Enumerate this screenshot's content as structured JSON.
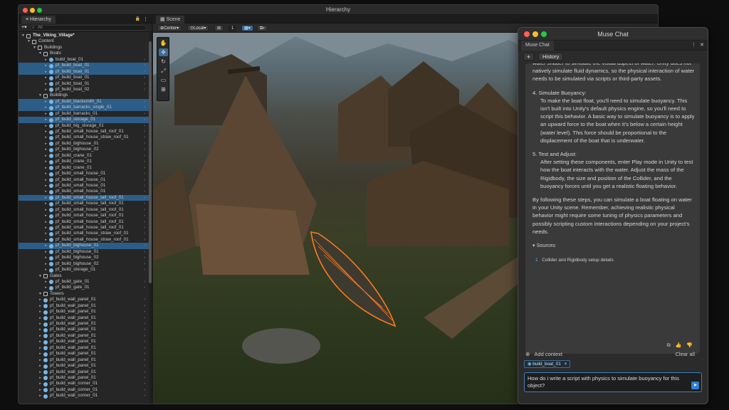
{
  "window": {
    "title": "Hierarchy"
  },
  "hierarchy": {
    "tab_label": "Hierarchy",
    "search_placeholder": "All",
    "rows": [
      {
        "label": "The_Viking_Village*",
        "depth": 0,
        "kind": "scene",
        "expanded": true,
        "selected": false,
        "bold": true
      },
      {
        "label": "Content",
        "depth": 1,
        "kind": "group",
        "expanded": true,
        "selected": false
      },
      {
        "label": "Buildings",
        "depth": 2,
        "kind": "group",
        "expanded": true,
        "selected": false
      },
      {
        "label": "Boats",
        "depth": 3,
        "kind": "group",
        "expanded": true,
        "selected": false
      },
      {
        "label": "build_boat_01",
        "depth": 4,
        "kind": "prefab",
        "selected": false
      },
      {
        "label": "pf_build_boat_01",
        "depth": 4,
        "kind": "prefab",
        "selected": true
      },
      {
        "label": "pf_build_boat_01",
        "depth": 4,
        "kind": "prefab",
        "selected": true
      },
      {
        "label": "pf_build_boat_01",
        "depth": 4,
        "kind": "prefab",
        "selected": false
      },
      {
        "label": "pf_build_boat_01",
        "depth": 4,
        "kind": "prefab",
        "selected": false
      },
      {
        "label": "pf_build_boat_02",
        "depth": 4,
        "kind": "prefab",
        "selected": false
      },
      {
        "label": "Buildings",
        "depth": 3,
        "kind": "group",
        "expanded": true,
        "selected": false
      },
      {
        "label": "pf_build_blacksmith_01",
        "depth": 4,
        "kind": "prefab",
        "selected": true
      },
      {
        "label": "pf_build_barracks_single_01",
        "depth": 4,
        "kind": "prefab",
        "selected": true
      },
      {
        "label": "pf_build_barracks_01",
        "depth": 4,
        "kind": "prefab",
        "selected": false
      },
      {
        "label": "pf_build_storage_01",
        "depth": 4,
        "kind": "prefab",
        "selected": true
      },
      {
        "label": "pf_build_big_storage_01",
        "depth": 4,
        "kind": "prefab",
        "selected": false
      },
      {
        "label": "pf_build_small_house_tall_roof_01",
        "depth": 4,
        "kind": "prefab",
        "selected": false
      },
      {
        "label": "pf_build_small_house_straw_roof_01",
        "depth": 4,
        "kind": "prefab",
        "selected": false
      },
      {
        "label": "pf_build_bighouse_01",
        "depth": 4,
        "kind": "prefab",
        "selected": false
      },
      {
        "label": "pf_build_bighouse_02",
        "depth": 4,
        "kind": "prefab",
        "selected": false
      },
      {
        "label": "pf_build_crane_01",
        "depth": 4,
        "kind": "prefab",
        "selected": false
      },
      {
        "label": "pf_build_crane_01",
        "depth": 4,
        "kind": "prefab",
        "selected": false
      },
      {
        "label": "pf_build_crane_01",
        "depth": 4,
        "kind": "prefab",
        "selected": false
      },
      {
        "label": "pf_build_small_house_01",
        "depth": 4,
        "kind": "prefab",
        "selected": false
      },
      {
        "label": "pf_build_small_house_01",
        "depth": 4,
        "kind": "prefab",
        "selected": false
      },
      {
        "label": "pf_build_small_house_01",
        "depth": 4,
        "kind": "prefab",
        "selected": false
      },
      {
        "label": "pf_build_small_house_01",
        "depth": 4,
        "kind": "prefab",
        "selected": false
      },
      {
        "label": "pf_build_small_house_tall_roof_01",
        "depth": 4,
        "kind": "prefab",
        "selected": true
      },
      {
        "label": "pf_build_small_house_tall_roof_01",
        "depth": 4,
        "kind": "prefab",
        "selected": false
      },
      {
        "label": "pf_build_small_house_tall_roof_01",
        "depth": 4,
        "kind": "prefab",
        "selected": false
      },
      {
        "label": "pf_build_small_house_tall_roof_01",
        "depth": 4,
        "kind": "prefab",
        "selected": false
      },
      {
        "label": "pf_build_small_house_tall_roof_01",
        "depth": 4,
        "kind": "prefab",
        "selected": false
      },
      {
        "label": "pf_build_small_house_tall_roof_01",
        "depth": 4,
        "kind": "prefab",
        "selected": false
      },
      {
        "label": "pf_build_small_house_straw_roof_01",
        "depth": 4,
        "kind": "prefab",
        "selected": false
      },
      {
        "label": "pf_build_small_house_straw_roof_01",
        "depth": 4,
        "kind": "prefab",
        "selected": false
      },
      {
        "label": "pf_build_bighouse_01",
        "depth": 4,
        "kind": "prefab",
        "selected": true
      },
      {
        "label": "pf_build_bighouse_01",
        "depth": 4,
        "kind": "prefab",
        "selected": false
      },
      {
        "label": "pf_build_bighouse_02",
        "depth": 4,
        "kind": "prefab",
        "selected": false
      },
      {
        "label": "pf_build_bighouse_02",
        "depth": 4,
        "kind": "prefab",
        "selected": false
      },
      {
        "label": "pf_build_storage_01",
        "depth": 4,
        "kind": "prefab",
        "selected": false
      },
      {
        "label": "Gates",
        "depth": 3,
        "kind": "group",
        "expanded": true,
        "selected": false
      },
      {
        "label": "pf_build_gate_01",
        "depth": 4,
        "kind": "prefab",
        "selected": false
      },
      {
        "label": "pf_build_gate_01",
        "depth": 4,
        "kind": "prefab",
        "selected": false
      },
      {
        "label": "Towers",
        "depth": 3,
        "kind": "group",
        "expanded": true,
        "selected": false
      },
      {
        "label": "pf_build_wall_panel_01",
        "depth": 3,
        "kind": "prefab",
        "selected": false
      },
      {
        "label": "pf_build_wall_panel_01",
        "depth": 3,
        "kind": "prefab",
        "selected": false
      },
      {
        "label": "pf_build_wall_panel_01",
        "depth": 3,
        "kind": "prefab",
        "selected": false
      },
      {
        "label": "pf_build_wall_panel_01",
        "depth": 3,
        "kind": "prefab",
        "selected": false
      },
      {
        "label": "pf_build_wall_panel_01",
        "depth": 3,
        "kind": "prefab",
        "selected": false
      },
      {
        "label": "pf_build_wall_panel_01",
        "depth": 3,
        "kind": "prefab",
        "selected": false
      },
      {
        "label": "pf_build_wall_panel_01",
        "depth": 3,
        "kind": "prefab",
        "selected": false
      },
      {
        "label": "pf_build_wall_panel_01",
        "depth": 3,
        "kind": "prefab",
        "selected": false
      },
      {
        "label": "pf_build_wall_panel_01",
        "depth": 3,
        "kind": "prefab",
        "selected": false
      },
      {
        "label": "pf_build_wall_panel_01",
        "depth": 3,
        "kind": "prefab",
        "selected": false
      },
      {
        "label": "pf_build_wall_panel_01",
        "depth": 3,
        "kind": "prefab",
        "selected": false
      },
      {
        "label": "pf_build_wall_panel_01",
        "depth": 3,
        "kind": "prefab",
        "selected": false
      },
      {
        "label": "pf_build_wall_panel_01",
        "depth": 3,
        "kind": "prefab",
        "selected": false
      },
      {
        "label": "pf_build_wall_panel_01",
        "depth": 3,
        "kind": "prefab",
        "selected": false
      },
      {
        "label": "pf_build_wall_corner_01",
        "depth": 3,
        "kind": "prefab",
        "selected": false
      },
      {
        "label": "pf_build_wall_corner_01",
        "depth": 3,
        "kind": "prefab",
        "selected": false
      },
      {
        "label": "pf_build_wall_corner_01",
        "depth": 3,
        "kind": "prefab",
        "selected": false
      }
    ]
  },
  "scene": {
    "tab_label": "Scene",
    "pivot_label": "Center",
    "space_label": "Local",
    "grid_value": "1"
  },
  "muse": {
    "title": "Muse Chat",
    "tab_label": "Muse Chat",
    "new_label": "+",
    "history_label": "History",
    "intro_lines": "water shader to simulate the visual aspect of water. Unity does not natively simulate fluid dynamics, so the physical interaction of water needs to be simulated via scripts or third-party assets.",
    "steps": [
      {
        "heading": "4. Simulate Buoyancy:",
        "body": "To make the boat float, you'll need to simulate buoyancy. This isn't built into Unity's default physics engine, so you'll need to script this behavior. A basic way to simulate buoyancy is to apply an upward force to the boat when it's below a certain height (water level). This force should be proportional to the displacement of the boat that is underwater."
      },
      {
        "heading": "5. Test and Adjust:",
        "body": "After setting these components, enter Play mode in Unity to test how the boat interacts with the water. Adjust the mass of the Rigidbody, the size and position of the Collider, and the buoyancy forces until you get a realistic floating behavior."
      }
    ],
    "summary": "By following these steps, you can simulate a boat floating on water in your Unity scene. Remember, achieving realistic physical behavior might require some tuning of physics parameters and possibly scripting custom interactions depending on your project's needs.",
    "sources_label": "Sources",
    "source_number": "1",
    "source_title": "Collider and Rigidbody setup details",
    "add_context_label": "Add context",
    "clear_all_label": "Clear all",
    "context_chip_label": "build_boat_01",
    "chip_close": "×",
    "input_value": "How do i write a script with physics to simulate buoyancy for this object?"
  },
  "colors": {
    "selection": "#2c5d87",
    "accent": "#2f7fd7",
    "prefab_icon": "#79b7e6"
  }
}
